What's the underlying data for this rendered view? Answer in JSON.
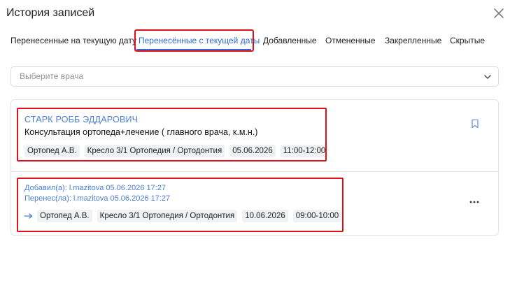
{
  "modal": {
    "title": "История записей",
    "close_icon": "close-icon"
  },
  "tabs": [
    {
      "label": "Перенесенные на текущую дату",
      "active": false
    },
    {
      "label": "Перенесённые с текущей даты",
      "active": true
    },
    {
      "label": "Добавленные",
      "active": false
    },
    {
      "label": "Отмененные",
      "active": false
    },
    {
      "label": "Закрепленные",
      "active": false
    },
    {
      "label": "Скрытые",
      "active": false
    }
  ],
  "doctor_select": {
    "placeholder": "Выберите врача",
    "icon": "chevron-down-icon"
  },
  "record": {
    "patient_name": "СТАРК РОББ ЭДДАРОВИЧ",
    "service": "Консультация ортопеда+лечение ( главного врача, к.м.н.)",
    "chips": [
      "Ортопед А.В.",
      "Кресло 3/1 Ортопедия / Ортодонтия",
      "05.06.2026",
      "11:00-12:00"
    ],
    "bookmark_icon": "bookmark-icon"
  },
  "history": {
    "added_by": "Добавил(а): l.mazitova 05.06.2026 17:27",
    "moved_by": "Перенес(ла): l.mazitova 05.06.2026 17:27",
    "arrow_icon": "arrow-right-icon",
    "chips": [
      "Ортопед А.В.",
      "Кресло 3/1 Ортопедия / Ортодонтия",
      "10.06.2026",
      "09:00-10:00"
    ],
    "more_icon": "more-horizontal-icon"
  },
  "colors": {
    "accent": "#2f6bd8",
    "link": "#4a7fd6",
    "highlight": "#e0101a",
    "chip_bg": "#f0f1f3"
  }
}
